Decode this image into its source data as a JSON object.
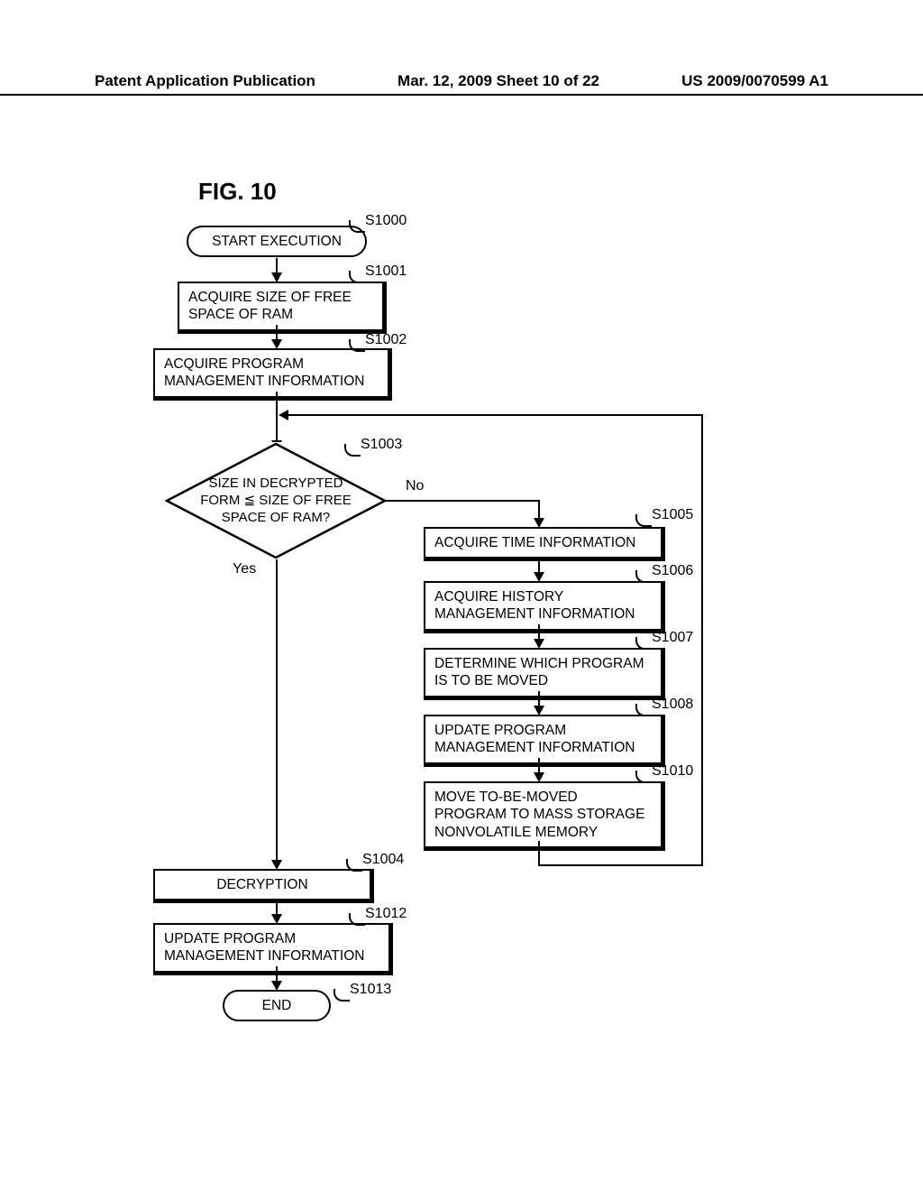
{
  "header": {
    "left": "Patent Application Publication",
    "center": "Mar. 12, 2009  Sheet 10 of 22",
    "right": "US 2009/0070599 A1"
  },
  "figure_title": "FIG. 10",
  "steps": {
    "s1000": {
      "label": "S1000",
      "text": "START EXECUTION"
    },
    "s1001": {
      "label": "S1001",
      "text": "ACQUIRE SIZE OF FREE SPACE OF RAM"
    },
    "s1002": {
      "label": "S1002",
      "text": "ACQUIRE PROGRAM MANAGEMENT INFORMATION"
    },
    "s1003": {
      "label": "S1003",
      "text": "SIZE IN DECRYPTED FORM ≦ SIZE OF FREE SPACE OF RAM?"
    },
    "s1004": {
      "label": "S1004",
      "text": "DECRYPTION"
    },
    "s1005": {
      "label": "S1005",
      "text": "ACQUIRE TIME INFORMATION"
    },
    "s1006": {
      "label": "S1006",
      "text": "ACQUIRE HISTORY MANAGEMENT INFORMATION"
    },
    "s1007": {
      "label": "S1007",
      "text": "DETERMINE WHICH PROGRAM IS TO BE MOVED"
    },
    "s1008": {
      "label": "S1008",
      "text": "UPDATE PROGRAM MANAGEMENT INFORMATION"
    },
    "s1010": {
      "label": "S1010",
      "text": "MOVE TO-BE-MOVED PROGRAM TO MASS STORAGE NONVOLATILE MEMORY"
    },
    "s1012": {
      "label": "S1012",
      "text": "UPDATE PROGRAM MANAGEMENT INFORMATION"
    },
    "s1013": {
      "label": "S1013",
      "text": "END"
    }
  },
  "branches": {
    "yes": "Yes",
    "no": "No"
  },
  "chart_data": {
    "type": "flowchart",
    "title": "FIG. 10",
    "nodes": [
      {
        "id": "S1000",
        "type": "terminal",
        "text": "START EXECUTION"
      },
      {
        "id": "S1001",
        "type": "process",
        "text": "ACQUIRE SIZE OF FREE SPACE OF RAM"
      },
      {
        "id": "S1002",
        "type": "process",
        "text": "ACQUIRE PROGRAM MANAGEMENT INFORMATION"
      },
      {
        "id": "S1003",
        "type": "decision",
        "text": "SIZE IN DECRYPTED FORM ≦ SIZE OF FREE SPACE OF RAM?"
      },
      {
        "id": "S1004",
        "type": "process",
        "text": "DECRYPTION"
      },
      {
        "id": "S1005",
        "type": "process",
        "text": "ACQUIRE TIME INFORMATION"
      },
      {
        "id": "S1006",
        "type": "process",
        "text": "ACQUIRE HISTORY MANAGEMENT INFORMATION"
      },
      {
        "id": "S1007",
        "type": "process",
        "text": "DETERMINE WHICH PROGRAM IS TO BE MOVED"
      },
      {
        "id": "S1008",
        "type": "process",
        "text": "UPDATE PROGRAM MANAGEMENT INFORMATION"
      },
      {
        "id": "S1010",
        "type": "process",
        "text": "MOVE TO-BE-MOVED PROGRAM TO MASS STORAGE NONVOLATILE MEMORY"
      },
      {
        "id": "S1012",
        "type": "process",
        "text": "UPDATE PROGRAM MANAGEMENT INFORMATION"
      },
      {
        "id": "S1013",
        "type": "terminal",
        "text": "END"
      }
    ],
    "edges": [
      {
        "from": "S1000",
        "to": "S1001"
      },
      {
        "from": "S1001",
        "to": "S1002"
      },
      {
        "from": "S1002",
        "to": "S1003"
      },
      {
        "from": "S1003",
        "to": "S1004",
        "label": "Yes"
      },
      {
        "from": "S1003",
        "to": "S1005",
        "label": "No"
      },
      {
        "from": "S1005",
        "to": "S1006"
      },
      {
        "from": "S1006",
        "to": "S1007"
      },
      {
        "from": "S1007",
        "to": "S1008"
      },
      {
        "from": "S1008",
        "to": "S1010"
      },
      {
        "from": "S1010",
        "to": "S1003",
        "note": "loop back"
      },
      {
        "from": "S1004",
        "to": "S1012"
      },
      {
        "from": "S1012",
        "to": "S1013"
      }
    ]
  }
}
